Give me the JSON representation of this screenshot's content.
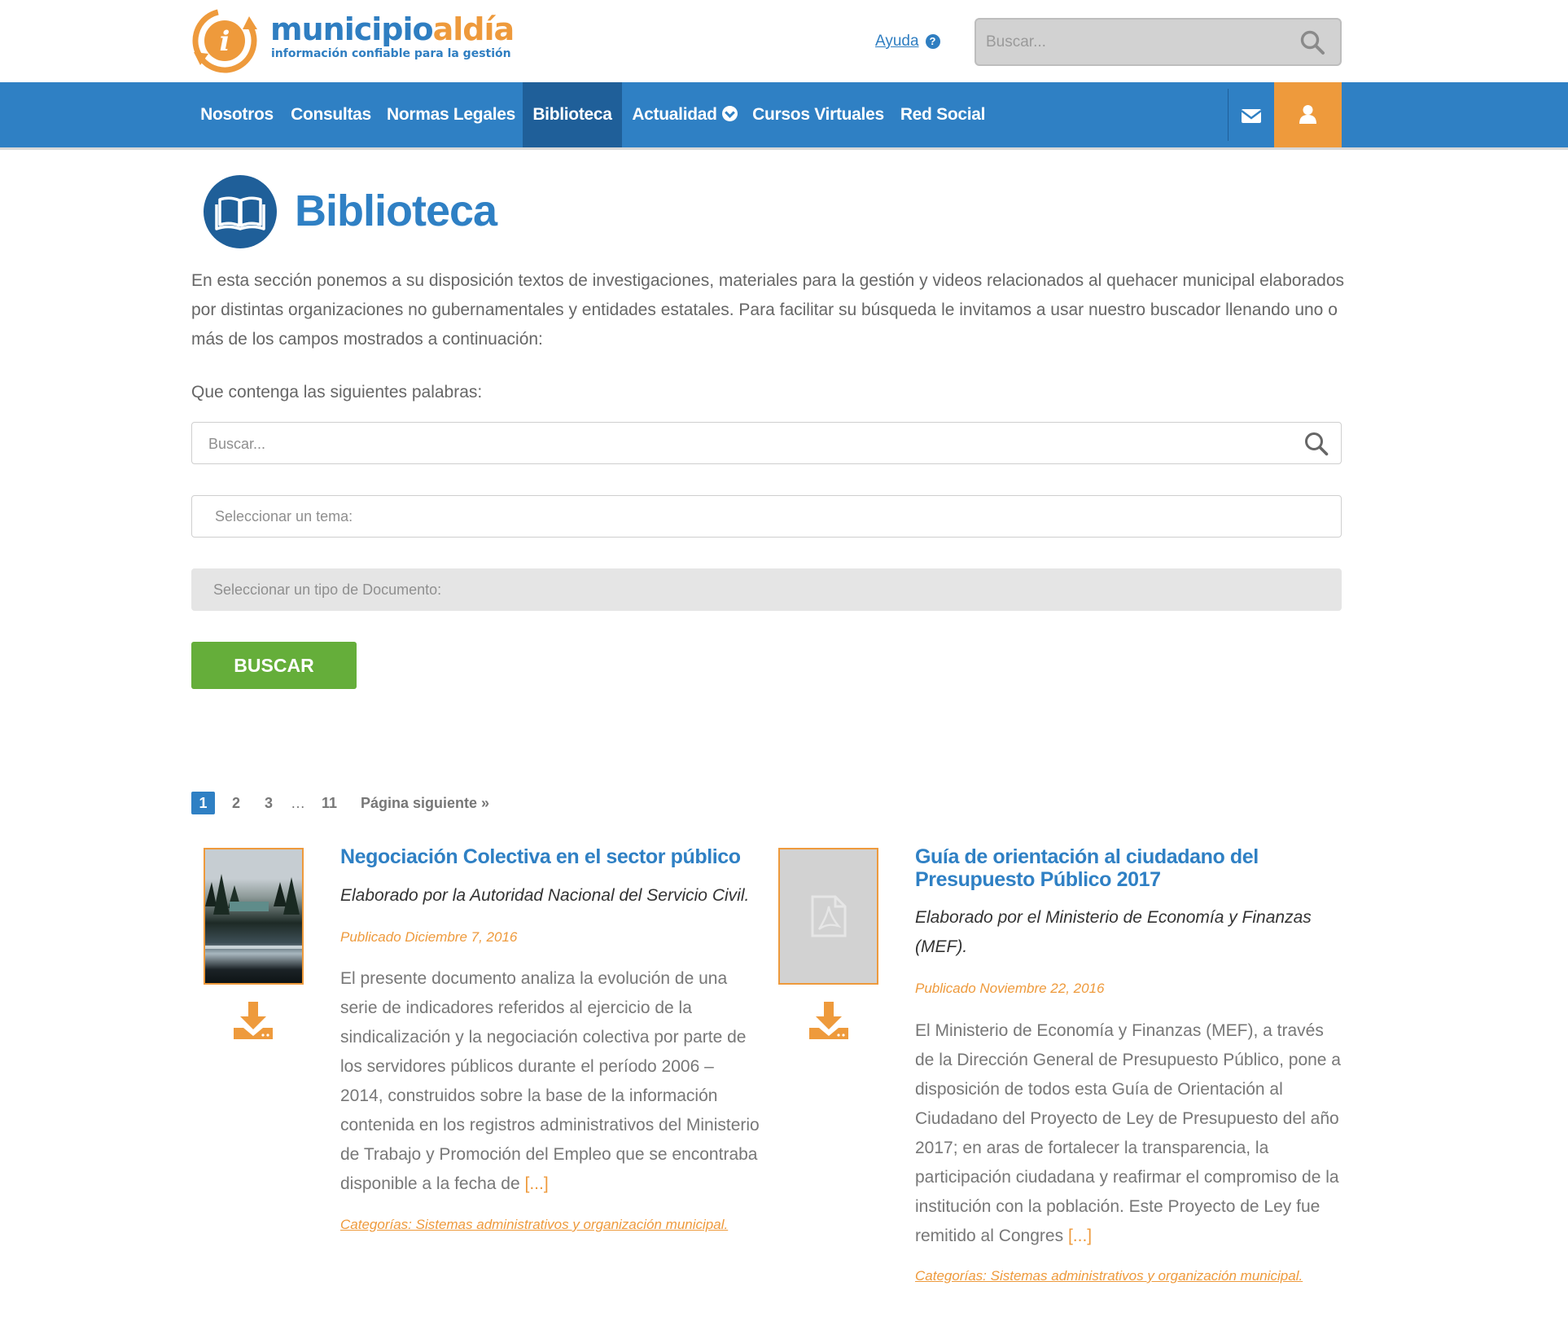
{
  "brand": {
    "name_part1": "municipio",
    "name_part2": "aldía",
    "tagline": "información confiable para la gestión"
  },
  "header": {
    "help_label": "Ayuda",
    "search_placeholder": "Buscar..."
  },
  "nav": {
    "items": [
      {
        "label": "Nosotros"
      },
      {
        "label": "Consultas"
      },
      {
        "label": "Normas Legales"
      },
      {
        "label": "Biblioteca"
      },
      {
        "label": "Actualidad"
      },
      {
        "label": "Cursos Virtuales"
      },
      {
        "label": "Red Social"
      }
    ],
    "active": "Biblioteca",
    "mail_icon": "envelope-icon",
    "user_icon": "user-icon"
  },
  "page": {
    "icon": "open-book-icon",
    "title": "Biblioteca",
    "intro": "En esta sección ponemos a su disposición textos de investigaciones, materiales para la gestión y videos relacionados al quehacer municipal elaborados por distintas organizaciones no gubernamentales y entidades estatales. Para facilitar su búsqueda le invitamos a usar nuestro buscador llenando uno o más de los campos mostrados a continuación:"
  },
  "form": {
    "words_label": "Que contenga las siguientes palabras:",
    "search_placeholder": "Buscar...",
    "tema_placeholder": "Seleccionar un tema:",
    "tipo_placeholder": "Seleccionar un tipo de Documento:",
    "submit_label": "BUSCAR"
  },
  "pagination": {
    "current": "1",
    "pages": [
      "2",
      "3"
    ],
    "ellipsis": "…",
    "last": "11",
    "next": "Página siguiente »"
  },
  "results": [
    {
      "title": "Negociación Colectiva en el sector público",
      "author": "Elaborado por la Autoridad Nacional del Servicio Civil.",
      "date": "Publicado Diciembre 7, 2016",
      "body": "El presente documento analiza la evolución de una serie de indicadores referidos al ejercicio de la sindicalización y la negociación colectiva por parte de los servidores públicos durante el período 2006 – 2014, construidos sobre la base de la información contenida en los registros administrativos del Ministerio de Trabajo y Promoción del Empleo que se encontraba disponible a la fecha de",
      "more": "[...]",
      "category": "Categorías: Sistemas administrativos y organización municipal.",
      "thumb": "landscape-cover-image",
      "download_icon": "download-icon"
    },
    {
      "title": "Guía de orientación al ciudadano del Presupuesto Público 2017",
      "author": "Elaborado por el Ministerio de Economía y Finanzas (MEF).",
      "date": "Publicado Noviembre 22, 2016",
      "body": "El Ministerio de Economía y Finanzas (MEF), a través de la Dirección General de Presupuesto Público, pone a disposición de todos esta Guía de Orientación al Ciudadano del Proyecto de Ley de Presupuesto del año 2017; en aras de fortalecer la transparencia, la participación ciudadana y reafirmar el compromiso de la institución con la población. Este Proyecto de Ley fue remitido al Congres",
      "more": "[...]",
      "category": "Categorías: Sistemas administrativos y organización municipal.",
      "thumb": "pdf-icon",
      "download_icon": "download-icon"
    }
  ],
  "colors": {
    "brand_blue": "#2f80c4",
    "nav_active": "#1f5f99",
    "accent_orange": "#ee9a3c",
    "button_green": "#65ae3a"
  }
}
